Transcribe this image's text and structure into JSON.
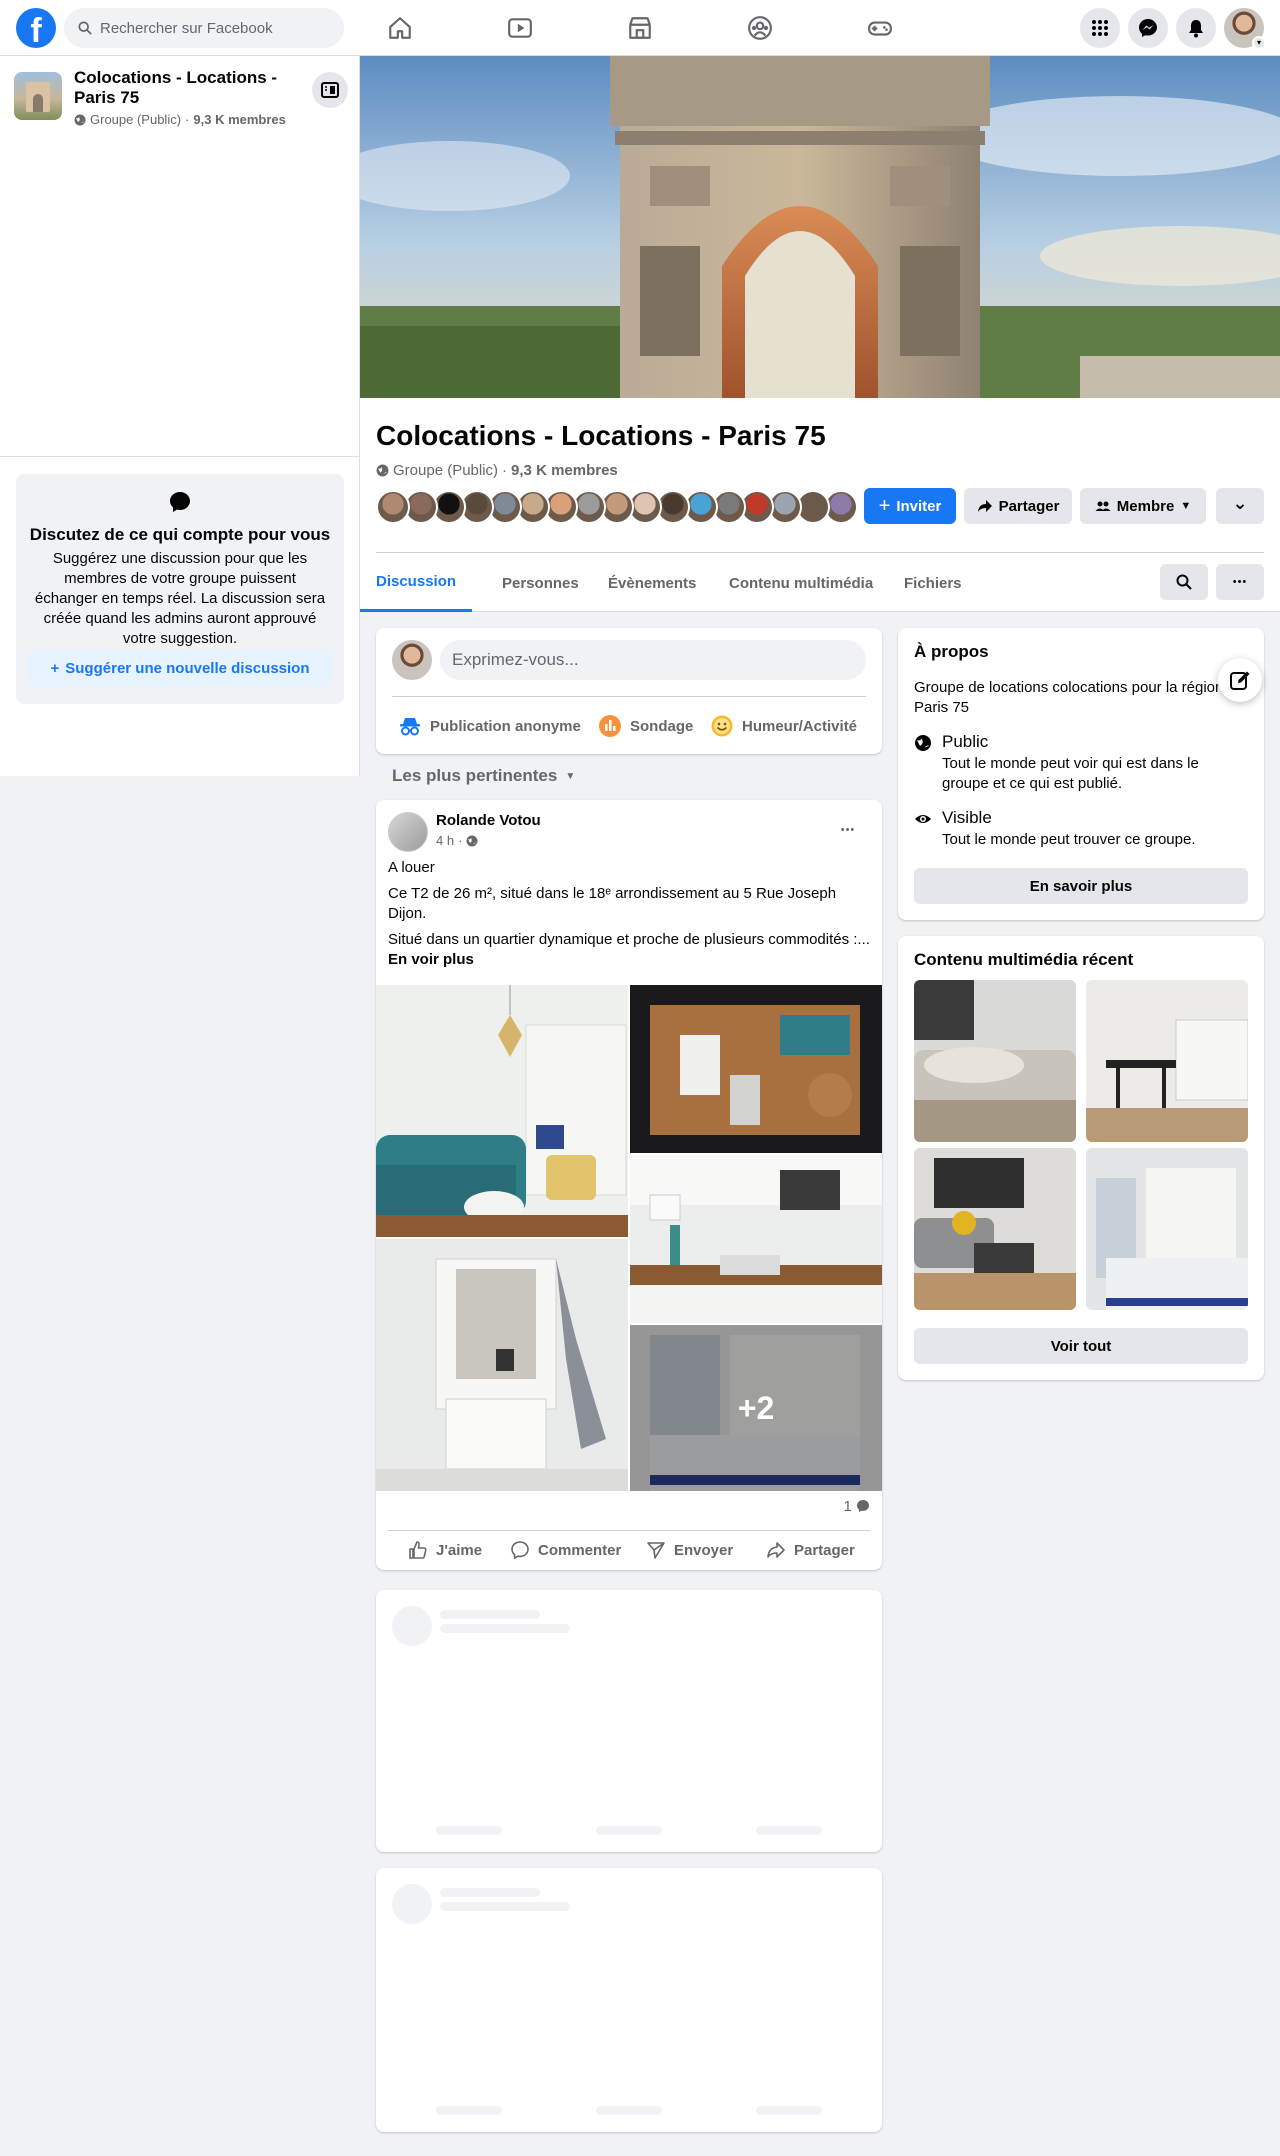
{
  "topbar": {
    "logo": "f",
    "search_placeholder": "Rechercher sur Facebook",
    "nav_icons": [
      "home-icon",
      "video-icon",
      "marketplace-icon",
      "groups-icon",
      "gaming-icon"
    ],
    "right_icons": [
      "menu-grid-icon",
      "messenger-icon",
      "bell-icon"
    ]
  },
  "sidebar": {
    "group_name": "Colocations - Locations - Paris 75",
    "privacy": "Groupe (Public)",
    "separator": "·",
    "members": "9,3 K membres",
    "suggest": {
      "title": "Discutez de ce qui compte pour vous",
      "text": "Suggérez une discussion pour que les membres de votre groupe puissent échanger en temps réel. La discussion sera créée quand les admins auront approuvé votre suggestion.",
      "button": "Suggérer une nouvelle discussion"
    }
  },
  "header": {
    "title": "Colocations - Locations - Paris 75",
    "privacy": "Groupe (Public)",
    "separator": "·",
    "members": "9,3 K membres",
    "invite": "Inviter",
    "share": "Partager",
    "member": "Membre",
    "more_glyph": "⌄",
    "face_colors": [
      "#b08a6e",
      "#8a6a5a",
      "#111111",
      "#5a4a3a",
      "#7f8a99",
      "#c7a98c",
      "#d9a07a",
      "#9b9b9b",
      "#c49a7a",
      "#e0c3b0",
      "#4a3a2e",
      "#4aa3d6",
      "#7a7a7a",
      "#c0392b",
      "#9aa5b1",
      "#6b5a4a",
      "#8e7aa8"
    ]
  },
  "tabs": [
    {
      "label": "Discussion"
    },
    {
      "label": "Personnes"
    },
    {
      "label": "Évènements"
    },
    {
      "label": "Contenu multimédia"
    },
    {
      "label": "Fichiers"
    }
  ],
  "composer": {
    "placeholder": "Exprimez-vous...",
    "actions": [
      {
        "label": "Publication anonyme",
        "icon": "incognito-icon"
      },
      {
        "label": "Sondage",
        "icon": "poll-icon"
      },
      {
        "label": "Humeur/Activité",
        "icon": "smiley-icon"
      }
    ]
  },
  "sort": {
    "label": "Les plus pertinentes"
  },
  "post": {
    "author": "Rolande Votou",
    "time": "4 h",
    "separator": "·",
    "more_glyph": "•••",
    "line1": "A louer",
    "line2": "Ce T2 de 26 m², situé dans le 18ᵉ arrondissement au 5 Rue Joseph Dijon.",
    "line3": "Situé dans un quartier dynamique et proche de plusieurs commodités :...",
    "see_more": "En voir plus",
    "extra_photos": "+2",
    "comments_count": "1",
    "actions": {
      "like": "J'aime",
      "comment": "Commenter",
      "send": "Envoyer",
      "share": "Partager"
    }
  },
  "about": {
    "title": "À propos",
    "description": "Groupe de locations colocations pour la région Paris 75",
    "public_title": "Public",
    "public_text": "Tout le monde peut voir qui est dans le groupe et ce qui est publié.",
    "visible_title": "Visible",
    "visible_text": "Tout le monde peut trouver ce groupe.",
    "button": "En savoir plus"
  },
  "media": {
    "title": "Contenu multimédia récent",
    "button": "Voir tout"
  },
  "colors": {
    "accent": "#1877f2",
    "background": "#f0f2f5",
    "secondary_text": "#65676b"
  }
}
